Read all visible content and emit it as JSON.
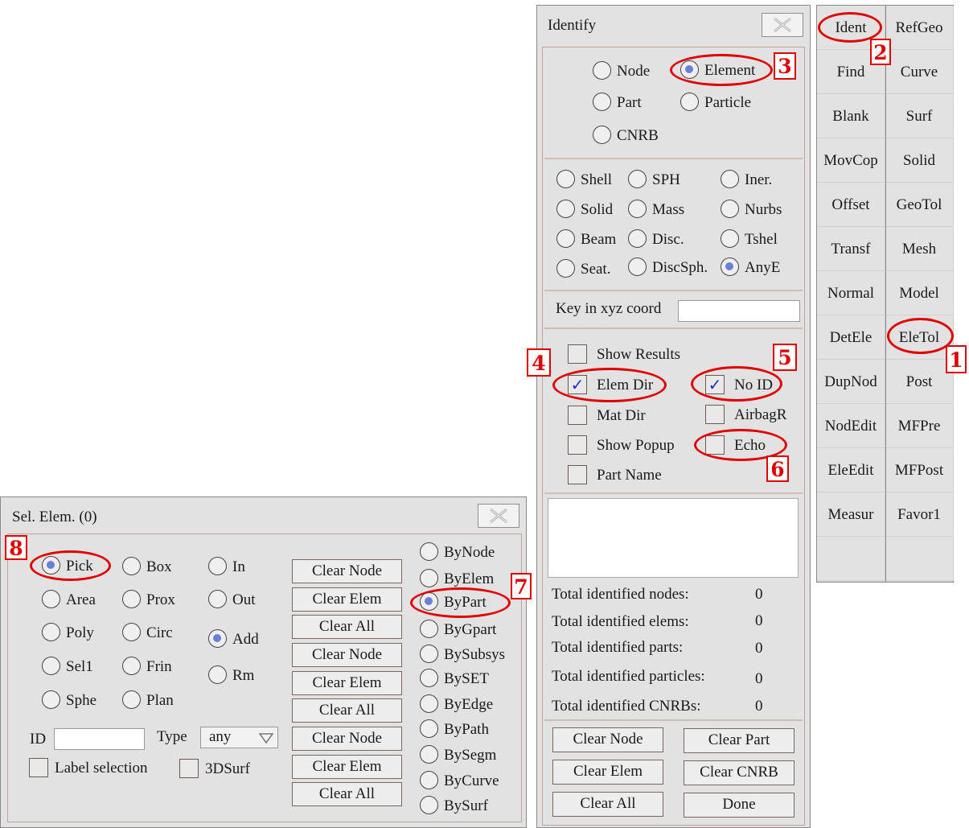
{
  "identify": {
    "title": "Identify",
    "entity_radios": [
      {
        "label": "Node",
        "selected": false
      },
      {
        "label": "Element",
        "selected": true
      },
      {
        "label": "Part",
        "selected": false
      },
      {
        "label": "Particle",
        "selected": false
      },
      {
        "label": "CNRB",
        "selected": false
      }
    ],
    "type_radios": [
      {
        "label": "Shell",
        "selected": false
      },
      {
        "label": "SPH",
        "selected": false
      },
      {
        "label": "Iner.",
        "selected": false
      },
      {
        "label": "Solid",
        "selected": false
      },
      {
        "label": "Mass",
        "selected": false
      },
      {
        "label": "Nurbs",
        "selected": false
      },
      {
        "label": "Beam",
        "selected": false
      },
      {
        "label": "Disc.",
        "selected": false
      },
      {
        "label": "Tshel",
        "selected": false
      },
      {
        "label": "Seat.",
        "selected": false
      },
      {
        "label": "DiscSph.",
        "selected": false
      },
      {
        "label": "AnyE",
        "selected": true
      }
    ],
    "key_in_label": "Key in xyz coord",
    "key_in_value": "",
    "checks": [
      {
        "label": "Show Results",
        "checked": false
      },
      {
        "label": "Elem Dir",
        "checked": true
      },
      {
        "label": "No ID",
        "checked": true
      },
      {
        "label": "Mat Dir",
        "checked": false
      },
      {
        "label": "AirbagR",
        "checked": false
      },
      {
        "label": "Show Popup",
        "checked": false
      },
      {
        "label": "Echo",
        "checked": false
      },
      {
        "label": "Part Name",
        "checked": false
      }
    ],
    "totals": [
      {
        "label": "Total identified nodes:",
        "value": "0"
      },
      {
        "label": "Total identified elems:",
        "value": "0"
      },
      {
        "label": "Total identified parts:",
        "value": "0"
      },
      {
        "label": "Total identified particles:",
        "value": "0"
      },
      {
        "label": "Total identified CNRBs:",
        "value": "0"
      }
    ],
    "buttons": [
      "Clear Node",
      "Clear Part",
      "Clear Elem",
      "Clear CNRB",
      "Clear All",
      "Done"
    ]
  },
  "toolbar": {
    "items": [
      "Ident",
      "RefGeo",
      "Find",
      "Curve",
      "Blank",
      "Surf",
      "MovCop",
      "Solid",
      "Offset",
      "GeoTol",
      "Transf",
      "Mesh",
      "Normal",
      "Model",
      "DetEle",
      "EleTol",
      "DupNod",
      "Post",
      "NodEdit",
      "MFPre",
      "EleEdit",
      "MFPost",
      "Measur",
      "Favor1",
      "",
      ""
    ]
  },
  "sel_elem": {
    "title": "Sel. Elem. (0)",
    "radios_col1": [
      {
        "label": "Pick",
        "selected": true
      },
      {
        "label": "Area",
        "selected": false
      },
      {
        "label": "Poly",
        "selected": false
      },
      {
        "label": "Sel1",
        "selected": false
      },
      {
        "label": "Sphe",
        "selected": false
      }
    ],
    "radios_col2": [
      {
        "label": "Box",
        "selected": false
      },
      {
        "label": "Prox",
        "selected": false
      },
      {
        "label": "Circ",
        "selected": false
      },
      {
        "label": "Frin",
        "selected": false
      },
      {
        "label": "Plan",
        "selected": false
      }
    ],
    "radios_col3": [
      {
        "label": "In",
        "selected": false
      },
      {
        "label": "Out",
        "selected": false
      },
      {
        "label": "Add",
        "selected": true
      },
      {
        "label": "Rm",
        "selected": false
      }
    ],
    "clear_buttons": [
      "Clear Node",
      "Clear Elem",
      "Clear All",
      "Clear Node",
      "Clear Elem",
      "Clear All",
      "Clear Node",
      "Clear Elem",
      "Clear All"
    ],
    "by_radios": [
      {
        "label": "ByNode",
        "selected": false
      },
      {
        "label": "ByElem",
        "selected": false
      },
      {
        "label": "ByPart",
        "selected": true
      },
      {
        "label": "ByGpart",
        "selected": false
      },
      {
        "label": "BySubsys",
        "selected": false
      },
      {
        "label": "BySET",
        "selected": false
      },
      {
        "label": "ByEdge",
        "selected": false
      },
      {
        "label": "ByPath",
        "selected": false
      },
      {
        "label": "BySegm",
        "selected": false
      },
      {
        "label": "ByCurve",
        "selected": false
      },
      {
        "label": "BySurf",
        "selected": false
      }
    ],
    "id_label": "ID",
    "id_value": "",
    "type_label": "Type",
    "type_value": "any",
    "label_selection": "Label selection",
    "surf3d": "3DSurf"
  },
  "annotations": [
    "1",
    "2",
    "3",
    "4",
    "5",
    "6",
    "7",
    "8"
  ],
  "colors": {
    "annotation": "#e00000",
    "radio_selected": "#6a7fd9",
    "check_mark": "#1f2fb8",
    "panel_bg": "#e2e2e2"
  }
}
